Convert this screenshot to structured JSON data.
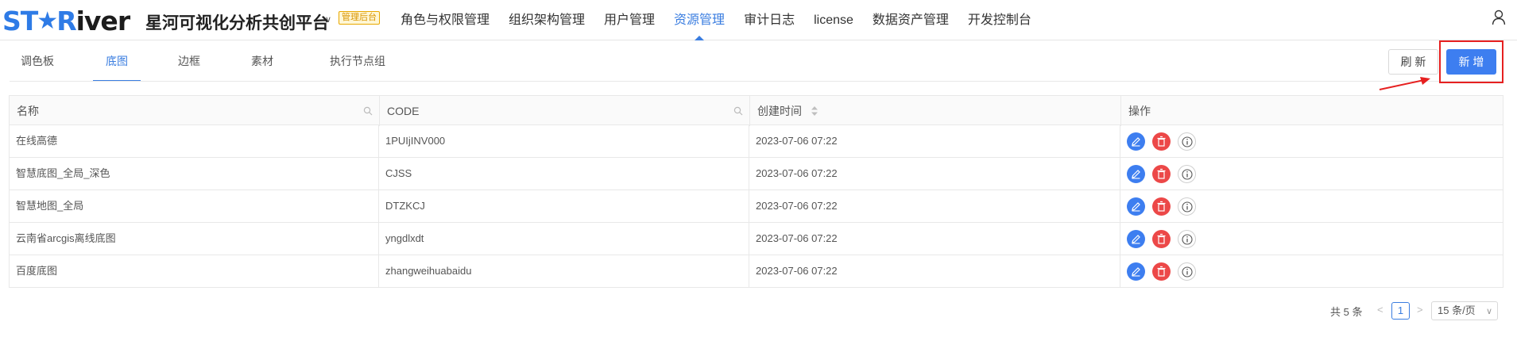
{
  "header": {
    "logo_part1": "ST",
    "logo_star": "★",
    "logo_part2": "R",
    "logo_part3": "iver",
    "title": "星河可视化分析共创平台",
    "badge": "管理后台",
    "nav": [
      {
        "label": "角色与权限管理"
      },
      {
        "label": "组织架构管理"
      },
      {
        "label": "用户管理"
      },
      {
        "label": "资源管理",
        "active": true
      },
      {
        "label": "审计日志"
      },
      {
        "label": "license"
      },
      {
        "label": "数据资产管理"
      },
      {
        "label": "开发控制台"
      }
    ]
  },
  "tabs": [
    {
      "label": "调色板"
    },
    {
      "label": "底图",
      "active": true
    },
    {
      "label": "边框"
    },
    {
      "label": "素材"
    },
    {
      "label": "执行节点组"
    }
  ],
  "toolbar": {
    "refresh_label": "刷 新",
    "add_label": "新 增"
  },
  "table": {
    "columns": [
      "名称",
      "CODE",
      "创建时间",
      "操作"
    ],
    "rows": [
      {
        "name": "在线高德",
        "code": "1PUIjINV000",
        "created": "2023-07-06 07:22"
      },
      {
        "name": "智慧底图_全局_深色",
        "code": "CJSS",
        "created": "2023-07-06 07:22"
      },
      {
        "name": "智慧地图_全局",
        "code": "DTZKCJ",
        "created": "2023-07-06 07:22"
      },
      {
        "name": "云南省arcgis离线底图",
        "code": "yngdlxdt",
        "created": "2023-07-06 07:22"
      },
      {
        "name": "百度底图",
        "code": "zhangweihuabaidu",
        "created": "2023-07-06 07:22"
      }
    ]
  },
  "pagination": {
    "total": "共 5 条",
    "prev": "<",
    "current": "1",
    "next": ">",
    "page_size": "15 条/页"
  },
  "colors": {
    "accent": "#3a7de0",
    "primary_button": "#3d7ef0",
    "danger": "#ec4848",
    "highlight": "#e62020"
  }
}
